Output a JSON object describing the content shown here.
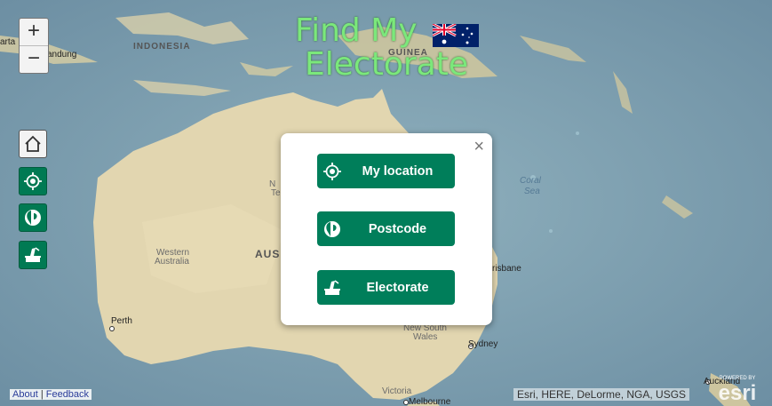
{
  "app": {
    "title_line1": "Find My",
    "title_line2": "Electorate"
  },
  "zoom": {
    "in_label": "+",
    "out_label": "−"
  },
  "modal": {
    "close_label": "×",
    "buttons": [
      {
        "label": "My location",
        "icon": "locate-icon"
      },
      {
        "label": "Postcode",
        "icon": "postcode-icon"
      },
      {
        "label": "Electorate",
        "icon": "ballot-box-icon"
      }
    ]
  },
  "map_labels": {
    "indonesia": "INDONESIA",
    "guinea": "GUINEA",
    "bandung": "andung",
    "karta": "arta",
    "coral_sea_1": "Coral",
    "coral_sea_2": "Sea",
    "western_australia_1": "Western",
    "western_australia_2": "Australia",
    "australia": "AUS",
    "perth": "Perth",
    "brisbane": "risbane",
    "sydney": "Sydney",
    "nsw_1": "New South",
    "nsw_2": "Wales",
    "victoria": "Victoria",
    "melbourne": "Melbourne",
    "auckland": "Auckland",
    "nt_1": "N",
    "nt_2": "Te"
  },
  "attribution": {
    "about": "About",
    "separator": "|",
    "feedback": "Feedback",
    "credits": "Esri, HERE, DeLorme, NGA, USGS",
    "esri_logo": "esri",
    "powered_by": "POWERED BY"
  },
  "colors": {
    "button_green": "#007e5a",
    "title_green": "#7be87b",
    "ocean": "#7f9fb0",
    "land": "#e2d6b0"
  }
}
